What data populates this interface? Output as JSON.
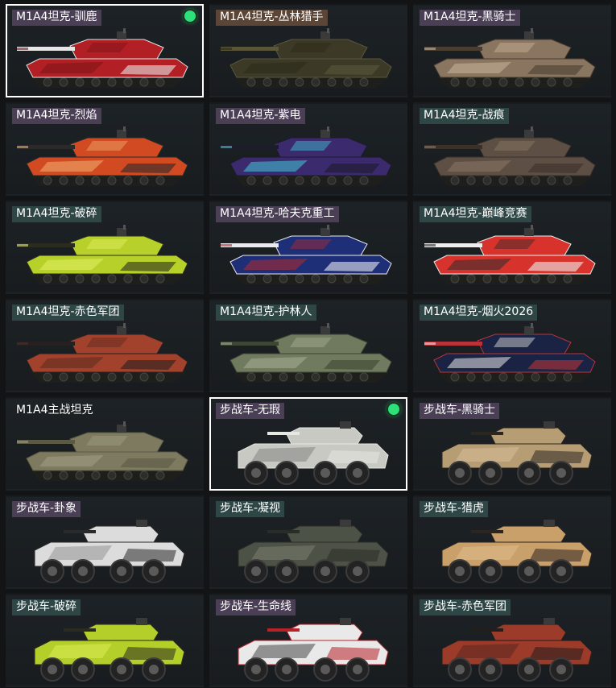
{
  "cards": [
    {
      "title": "M1A4坦克-驯鹿",
      "kind": "tank",
      "selected": true,
      "equipped": true,
      "titleBg": "#4a3f55",
      "colors": [
        "#b21f24",
        "#e6e6e6",
        "#7a1418"
      ]
    },
    {
      "title": "M1A4坦克-丛林猎手",
      "kind": "tank",
      "selected": false,
      "equipped": false,
      "titleBg": "#5a4536",
      "colors": [
        "#3c3a26",
        "#59563a",
        "#2a2919"
      ]
    },
    {
      "title": "M1A4坦克-黑骑士",
      "kind": "tank",
      "selected": false,
      "equipped": false,
      "titleBg": "#4a3f55",
      "colors": [
        "#8a7560",
        "#4a3d32",
        "#c9b59a"
      ]
    },
    {
      "title": "M1A4坦克-烈焰",
      "kind": "tank",
      "selected": false,
      "equipped": false,
      "titleBg": "#4a3f55",
      "colors": [
        "#d24a22",
        "#2a2a2a",
        "#f0b070"
      ]
    },
    {
      "title": "M1A4坦克-紫电",
      "kind": "tank",
      "selected": false,
      "equipped": false,
      "titleBg": "#4a3f55",
      "colors": [
        "#3b2a6e",
        "#1c1c2a",
        "#43c7d9"
      ]
    },
    {
      "title": "M1A4坦克-战痕",
      "kind": "tank",
      "selected": false,
      "equipped": false,
      "titleBg": "#2f4646",
      "colors": [
        "#5e4f44",
        "#3a312b",
        "#8b7968"
      ]
    },
    {
      "title": "M1A4坦克-破碎",
      "kind": "tank",
      "selected": false,
      "equipped": false,
      "titleBg": "#2f4646",
      "colors": [
        "#b8d12a",
        "#2b2b1f",
        "#e2f063"
      ]
    },
    {
      "title": "M1A4坦克-哈夫克重工",
      "kind": "tank",
      "selected": false,
      "equipped": false,
      "titleBg": "#4a3f55",
      "colors": [
        "#1e2f78",
        "#e9e9ef",
        "#b62a2a"
      ]
    },
    {
      "title": "M1A4坦克-巅峰竞赛",
      "kind": "tank",
      "selected": false,
      "equipped": false,
      "titleBg": "#2f4646",
      "colors": [
        "#d7322b",
        "#eeeeee",
        "#2d2d2d"
      ]
    },
    {
      "title": "M1A4坦克-赤色军团",
      "kind": "tank",
      "selected": false,
      "equipped": false,
      "titleBg": "#2f4646",
      "colors": [
        "#a2412c",
        "#262120",
        "#5b2b20"
      ]
    },
    {
      "title": "M1A4坦克-护林人",
      "kind": "tank",
      "selected": false,
      "equipped": false,
      "titleBg": "#2f4646",
      "colors": [
        "#6f7a5e",
        "#3e4634",
        "#a8ad96"
      ]
    },
    {
      "title": "M1A4坦克-烟火2026",
      "kind": "tank",
      "selected": false,
      "equipped": false,
      "titleBg": "#2f4646",
      "colors": [
        "#1a2343",
        "#b8343a",
        "#e7e7e7"
      ]
    },
    {
      "title": "M1A4主战坦克",
      "kind": "tank",
      "selected": false,
      "equipped": false,
      "titleBg": "transparent",
      "colors": [
        "#7d7a5f",
        "#5b5944",
        "#a29f83"
      ]
    },
    {
      "title": "步战车-无瑕",
      "kind": "ifv",
      "selected": true,
      "equipped": true,
      "titleBg": "#4a3f55",
      "colors": [
        "#c9c9c4",
        "#e6e6e2",
        "#7d7d79"
      ]
    },
    {
      "title": "步战车-黑骑士",
      "kind": "ifv",
      "selected": false,
      "equipped": false,
      "titleBg": "#4a3f55",
      "colors": [
        "#b79d74",
        "#2b2620",
        "#d9c29a"
      ]
    },
    {
      "title": "步战车-卦象",
      "kind": "ifv",
      "selected": false,
      "equipped": false,
      "titleBg": "#4a3f55",
      "colors": [
        "#dcdcdc",
        "#2a2a2a",
        "#8d8d8d"
      ]
    },
    {
      "title": "步战车-凝视",
      "kind": "ifv",
      "selected": false,
      "equipped": false,
      "titleBg": "#2f4646",
      "colors": [
        "#4d5246",
        "#2a2c27",
        "#7f8173"
      ]
    },
    {
      "title": "步战车-猎虎",
      "kind": "ifv",
      "selected": false,
      "equipped": false,
      "titleBg": "#2f4646",
      "colors": [
        "#caa06a",
        "#2c2520",
        "#e2c08e"
      ]
    },
    {
      "title": "步战车-破碎",
      "kind": "ifv",
      "selected": false,
      "equipped": false,
      "titleBg": "#2f4646",
      "colors": [
        "#b4cf29",
        "#2b2b1f",
        "#e0ef5a"
      ]
    },
    {
      "title": "步战车-生命线",
      "kind": "ifv",
      "selected": false,
      "equipped": false,
      "titleBg": "#4a3f55",
      "colors": [
        "#e9e9e9",
        "#b8232a",
        "#3a3a3a"
      ]
    },
    {
      "title": "步战车-赤色军团",
      "kind": "ifv",
      "selected": false,
      "equipped": false,
      "titleBg": "#2f4646",
      "colors": [
        "#9c3b2a",
        "#221e1c",
        "#53261d"
      ]
    }
  ]
}
